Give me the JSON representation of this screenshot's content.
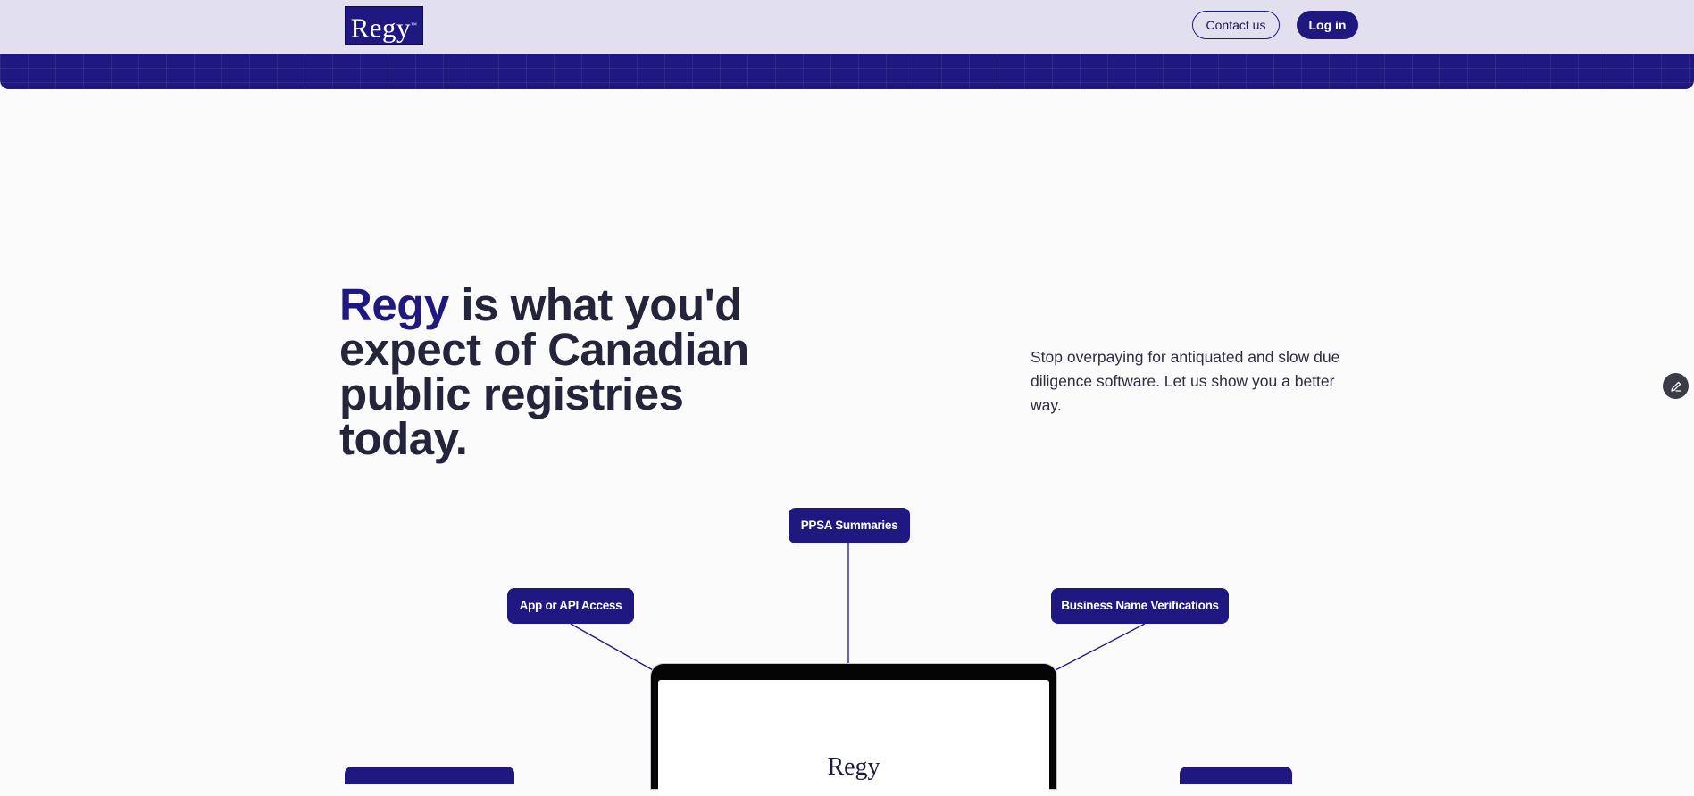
{
  "nav": {
    "logo_text": "Regy",
    "logo_mark": "™",
    "contact_label": "Contact us",
    "login_label": "Log in"
  },
  "hero": {
    "brand_word": "Regy",
    "heading_rest": " is what you'd expect of Canadian public registries today.",
    "subtext": "Stop overpaying for antiquated and slow due diligence software. Let us show you a better way."
  },
  "features": {
    "ppsa": "PPSA Summaries",
    "api": "App or API Access",
    "business_name": "Business Name Verifications"
  },
  "laptop": {
    "screen_logo": "Regy"
  },
  "colors": {
    "brand": "#1f1880",
    "topbar": "#e2e0ef",
    "text": "#24243a"
  },
  "icons": {
    "edit": "pencil-icon"
  }
}
